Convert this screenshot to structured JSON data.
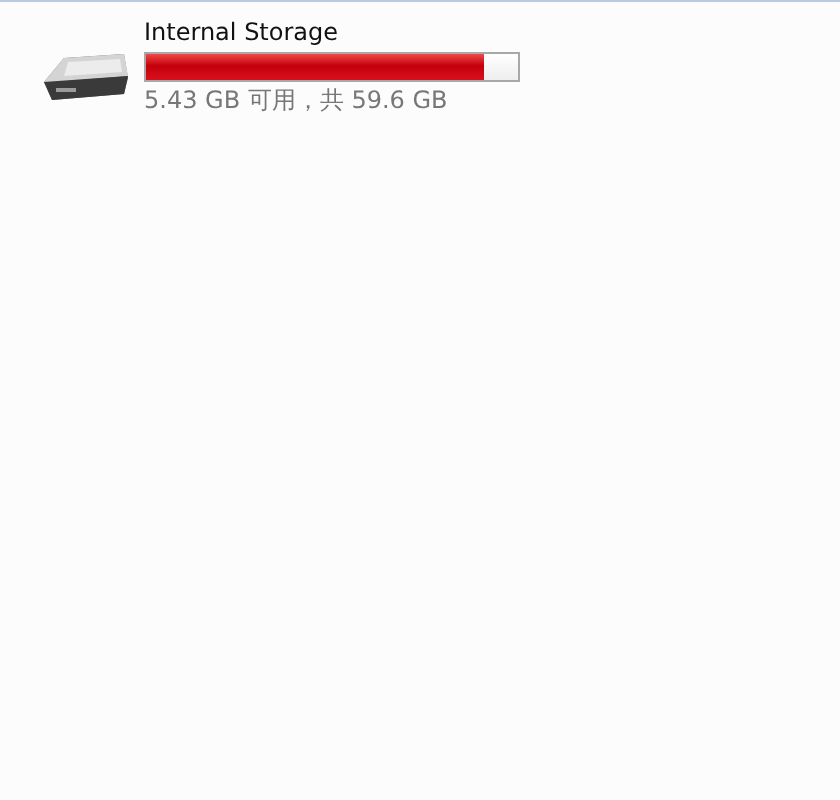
{
  "drives": [
    {
      "name": "Internal Storage",
      "level": 0.91,
      "space": "5.43 GB 可用，共 59.6 GB"
    }
  ]
}
